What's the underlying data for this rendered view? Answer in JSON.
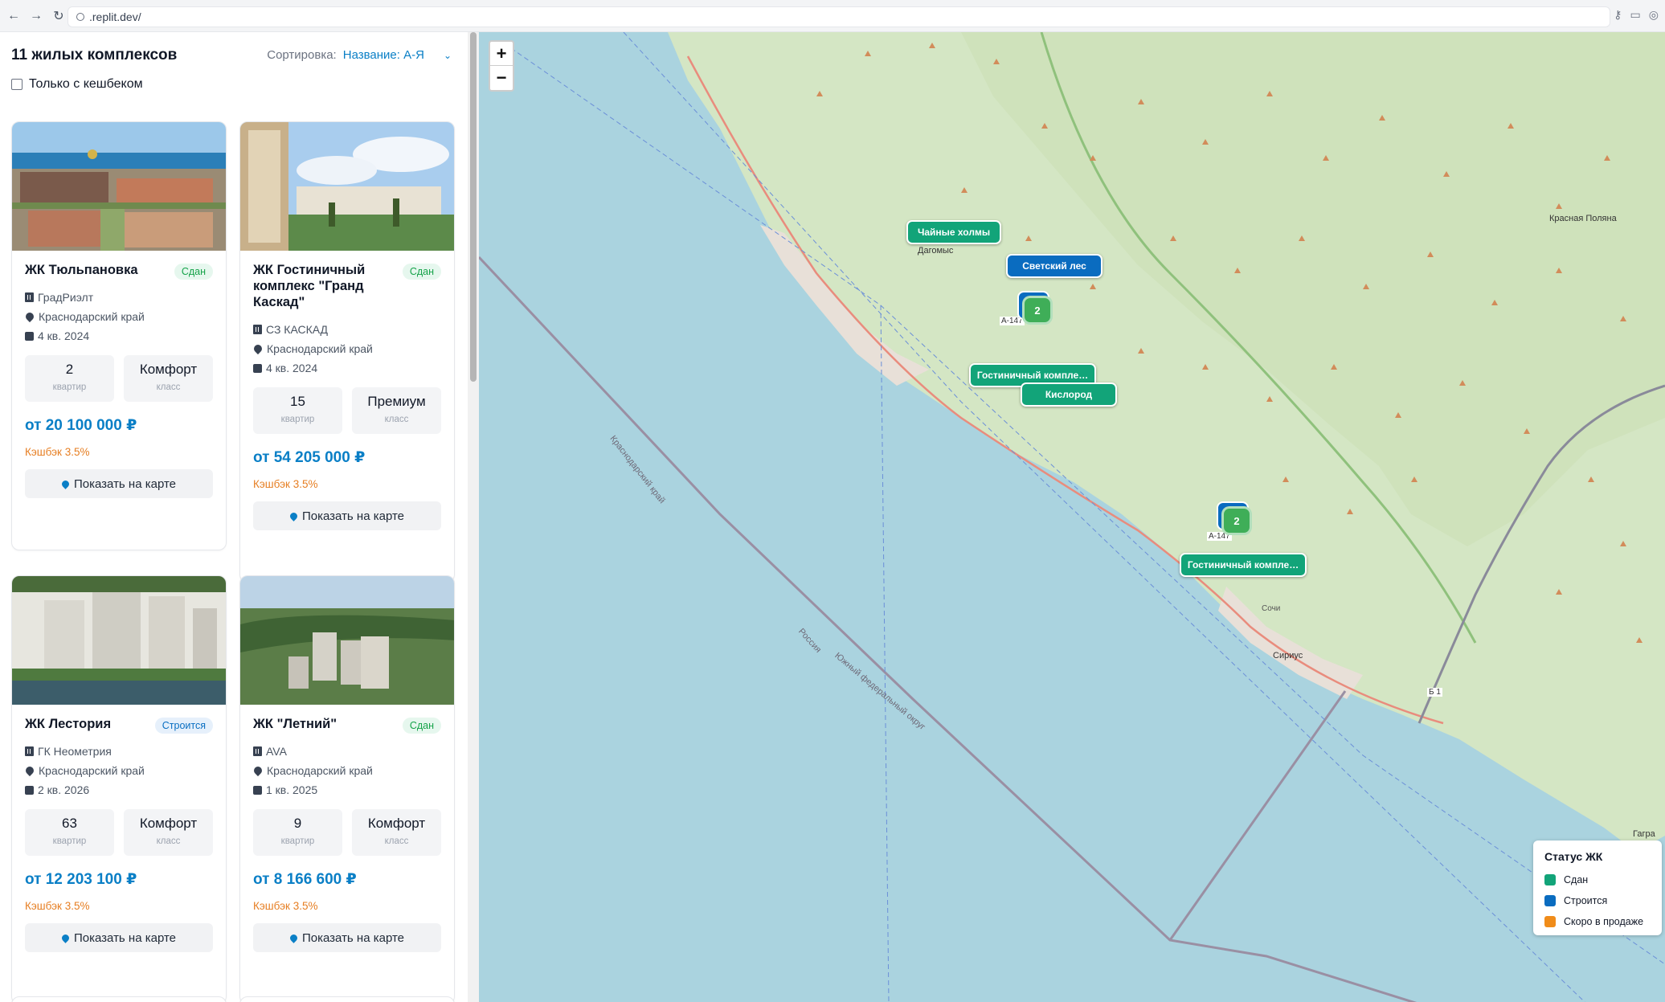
{
  "browser": {
    "url": ".replit.dev/"
  },
  "listing": {
    "count_title": "11 жилых комплексов",
    "sort_label": "Сортировка:",
    "sort_value": "Название: А-Я",
    "cashback_only_label": "Только с кешбеком"
  },
  "cards": [
    {
      "title": "ЖК Тюльпановка",
      "status": "Сдан",
      "developer": "ГрадРиэлт",
      "region": "Краснодарский край",
      "deadline": "4 кв. 2024",
      "apartments": "2",
      "apartments_label": "квартир",
      "class": "Комфорт",
      "class_label": "класс",
      "price": "от 20 100 000 ₽",
      "cashback": "Кэшбэк 3.5%",
      "map_button": "Показать на карте"
    },
    {
      "title": "ЖК Гостиничный комплекс \"Гранд Каскад\"",
      "status": "Сдан",
      "developer": "СЗ КАСКАД",
      "region": "Краснодарский край",
      "deadline": "4 кв. 2024",
      "apartments": "15",
      "apartments_label": "квартир",
      "class": "Премиум",
      "class_label": "класс",
      "price": "от 54 205 000 ₽",
      "cashback": "Кэшбэк 3.5%",
      "map_button": "Показать на карте"
    },
    {
      "title": "ЖК Лестория",
      "status": "Строится",
      "developer": "ГК Неометрия",
      "region": "Краснодарский край",
      "deadline": "2 кв. 2026",
      "apartments": "63",
      "apartments_label": "квартир",
      "class": "Комфорт",
      "class_label": "класс",
      "price": "от 12 203 100 ₽",
      "cashback": "Кэшбэк 3.5%",
      "map_button": "Показать на карте"
    },
    {
      "title": "ЖК \"Летний\"",
      "status": "Сдан",
      "developer": "AVA",
      "region": "Краснодарский край",
      "deadline": "1 кв. 2025",
      "apartments": "9",
      "apartments_label": "квартир",
      "class": "Комфорт",
      "class_label": "класс",
      "price": "от 8 166 600 ₽",
      "cashback": "Кэшбэк 3.5%",
      "map_button": "Показать на карте"
    }
  ],
  "map": {
    "zoom_in": "+",
    "zoom_out": "−",
    "markers": [
      {
        "label": "Чайные холмы",
        "status": "done"
      },
      {
        "label": "Светский лес",
        "status": "building"
      },
      {
        "label": "Гостиничный компле…",
        "status": "done"
      },
      {
        "label": "Кислород",
        "status": "done"
      },
      {
        "label": "Гостиничный компле…",
        "status": "done"
      }
    ],
    "clusters": [
      {
        "count": "2"
      },
      {
        "count": "2"
      }
    ],
    "places": [
      "Дагомыс",
      "Красная Поляна",
      "Сочи",
      "Сириус",
      "Гагра",
      "Краснодарский край",
      "Россия",
      "Южный федеральный округ"
    ],
    "roads": [
      "А-147",
      "А-147",
      "Б 1"
    ],
    "legend": {
      "title": "Статус ЖК",
      "items": [
        {
          "label": "Сдан",
          "color": "#12a479"
        },
        {
          "label": "Строится",
          "color": "#0a6cc0"
        },
        {
          "label": "Скоро в продаже",
          "color": "#f08c1a"
        }
      ]
    }
  }
}
